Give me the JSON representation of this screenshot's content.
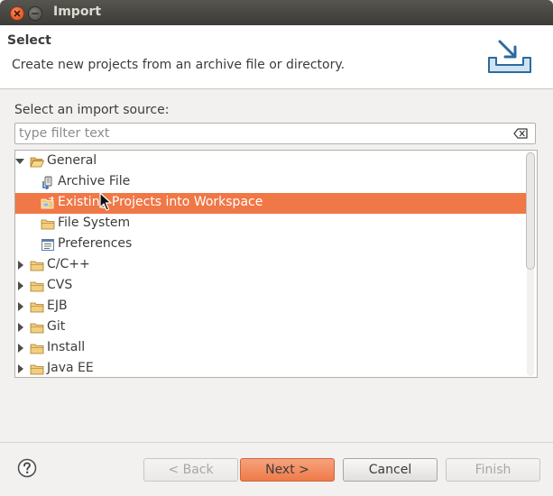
{
  "window": {
    "title": "Import"
  },
  "banner": {
    "title": "Select",
    "description": "Create new projects from an archive file or directory."
  },
  "source_label": "Select an import source:",
  "filter": {
    "placeholder": "type filter text",
    "value": ""
  },
  "tree": {
    "items": [
      {
        "label": "General",
        "level": 0,
        "expanded": true,
        "icon": "folder-open-icon"
      },
      {
        "label": "Archive File",
        "level": 1,
        "icon": "archive-file-icon"
      },
      {
        "label": "Existing Projects into Workspace",
        "level": 1,
        "icon": "existing-projects-icon",
        "selected": true
      },
      {
        "label": "File System",
        "level": 1,
        "icon": "folder-icon"
      },
      {
        "label": "Preferences",
        "level": 1,
        "icon": "preferences-icon"
      },
      {
        "label": "C/C++",
        "level": 0,
        "expanded": false,
        "icon": "folder-icon"
      },
      {
        "label": "CVS",
        "level": 0,
        "expanded": false,
        "icon": "folder-icon"
      },
      {
        "label": "EJB",
        "level": 0,
        "expanded": false,
        "icon": "folder-icon"
      },
      {
        "label": "Git",
        "level": 0,
        "expanded": false,
        "icon": "folder-icon"
      },
      {
        "label": "Install",
        "level": 0,
        "expanded": false,
        "icon": "folder-icon"
      },
      {
        "label": "Java EE",
        "level": 0,
        "expanded": false,
        "icon": "folder-icon"
      }
    ]
  },
  "buttons": {
    "back": "< Back",
    "next": "Next >",
    "cancel": "Cancel",
    "finish": "Finish"
  },
  "colors": {
    "selection": "#f07746",
    "primary_button": "#ef7a49",
    "titlebar": "#3c3b37"
  }
}
